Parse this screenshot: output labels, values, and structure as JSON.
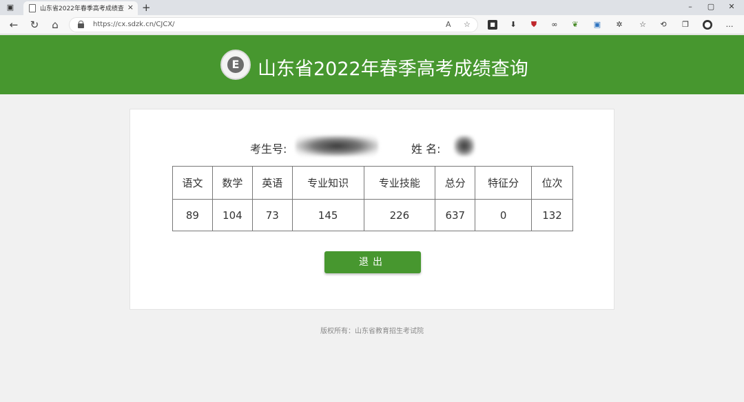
{
  "browser": {
    "tab_title": "山东省2022年春季高考成绩查询",
    "tab_close": "×",
    "new_tab": "+",
    "url": "https://cx.sdzk.cn/CJCX/",
    "window_controls": {
      "minimize": "–",
      "maximize": "▢",
      "close": "✕"
    },
    "nav": {
      "back": "←",
      "refresh": "↻",
      "home": "⌂"
    },
    "toolbar_more": "…"
  },
  "header": {
    "logo_letter": "E",
    "title": "山东省2022年春季高考成绩查询"
  },
  "student": {
    "id_label": "考生号:",
    "name_label": "姓 名:"
  },
  "scores": {
    "columns": [
      "语文",
      "数学",
      "英语",
      "专业知识",
      "专业技能",
      "总分",
      "特征分",
      "位次"
    ],
    "values": [
      "89",
      "104",
      "73",
      "145",
      "226",
      "637",
      "0",
      "132"
    ]
  },
  "actions": {
    "exit_label": "退出"
  },
  "footer": {
    "copyright": "版权所有：山东省教育招生考试院"
  },
  "colors": {
    "brand_green": "#47972f",
    "page_bg": "#f1f1f1"
  }
}
